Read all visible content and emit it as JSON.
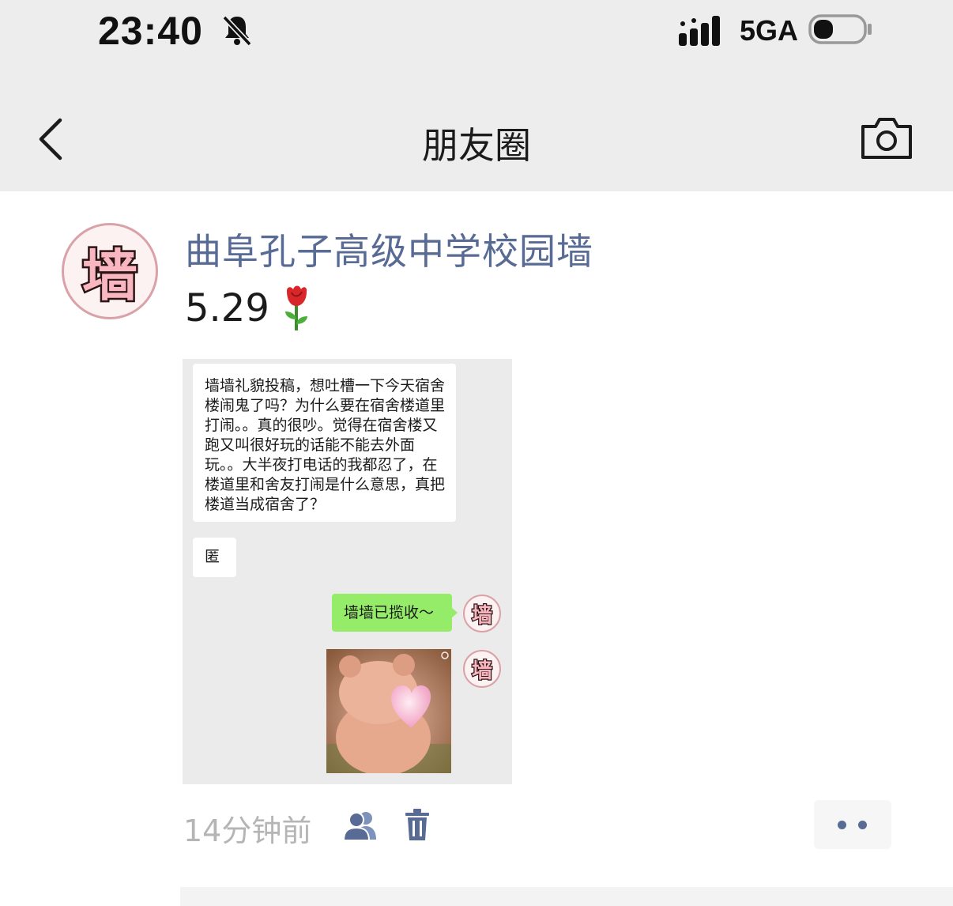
{
  "status_bar": {
    "time": "23:40",
    "network": "5GA",
    "icons": [
      "bell-muted-icon",
      "signal-icon",
      "battery-icon"
    ]
  },
  "nav": {
    "title": "朋友圈",
    "back_icon": "chevron-left-icon",
    "camera_icon": "camera-icon"
  },
  "post": {
    "avatar_text": "墙",
    "author": "曲阜孔子高级中学校园墙",
    "text": "5.29",
    "emoji": "rose-emoji",
    "time_ago": "14分钟前",
    "icons": [
      "privacy-icon",
      "delete-icon",
      "more-icon"
    ],
    "colors": {
      "author": "#576b95",
      "meta": "#b5b5b5"
    }
  },
  "screenshot": {
    "incoming_messages": [
      "墙墙礼貌投稿，想吐槽一下今天宿舍楼闹鬼了吗？为什么要在宿舍楼道里打闹。。真的很吵。觉得在宿舍楼又跑又叫很好玩的话能不能去外面玩。。大半夜打电话的我都忍了，在楼道里和舍友打闹是什么意思，真把楼道当成宿舍了？",
      "匿"
    ],
    "outgoing_message": "墙墙已揽收～",
    "avatar_text": "墙",
    "colors": {
      "background": "#ebebeb",
      "outgoing_bubble": "#95ec69"
    }
  }
}
